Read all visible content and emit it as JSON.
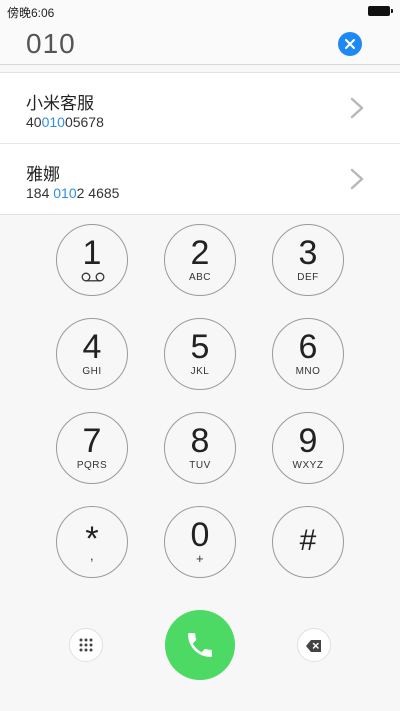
{
  "status": {
    "time": "傍晚6:06"
  },
  "dialer": {
    "number": "010"
  },
  "results": [
    {
      "name": "小米客服",
      "number_parts": [
        "40",
        "010",
        "05678"
      ]
    },
    {
      "name": "雅娜",
      "number_parts": [
        "184 ",
        "010",
        "2 4685"
      ]
    }
  ],
  "keys": [
    {
      "digit": "1",
      "letters": ""
    },
    {
      "digit": "2",
      "letters": "ABC"
    },
    {
      "digit": "3",
      "letters": "DEF"
    },
    {
      "digit": "4",
      "letters": "GHI"
    },
    {
      "digit": "5",
      "letters": "JKL"
    },
    {
      "digit": "6",
      "letters": "MNO"
    },
    {
      "digit": "7",
      "letters": "PQRS"
    },
    {
      "digit": "8",
      "letters": "TUV"
    },
    {
      "digit": "9",
      "letters": "WXYZ"
    },
    {
      "digit": "*",
      "letters": ","
    },
    {
      "digit": "0",
      "letters": "+"
    },
    {
      "digit": "#",
      "letters": ""
    }
  ],
  "icons": {
    "clear": "clear-icon",
    "voicemail": "voicemail-icon",
    "keypad_grid": "keypad-grid-icon",
    "call": "phone-icon",
    "backspace": "backspace-icon",
    "chevron": "chevron-right-icon"
  },
  "colors": {
    "accent_blue": "#1e88f5",
    "highlight": "#2f8ee5",
    "call_green": "#4cd964"
  }
}
